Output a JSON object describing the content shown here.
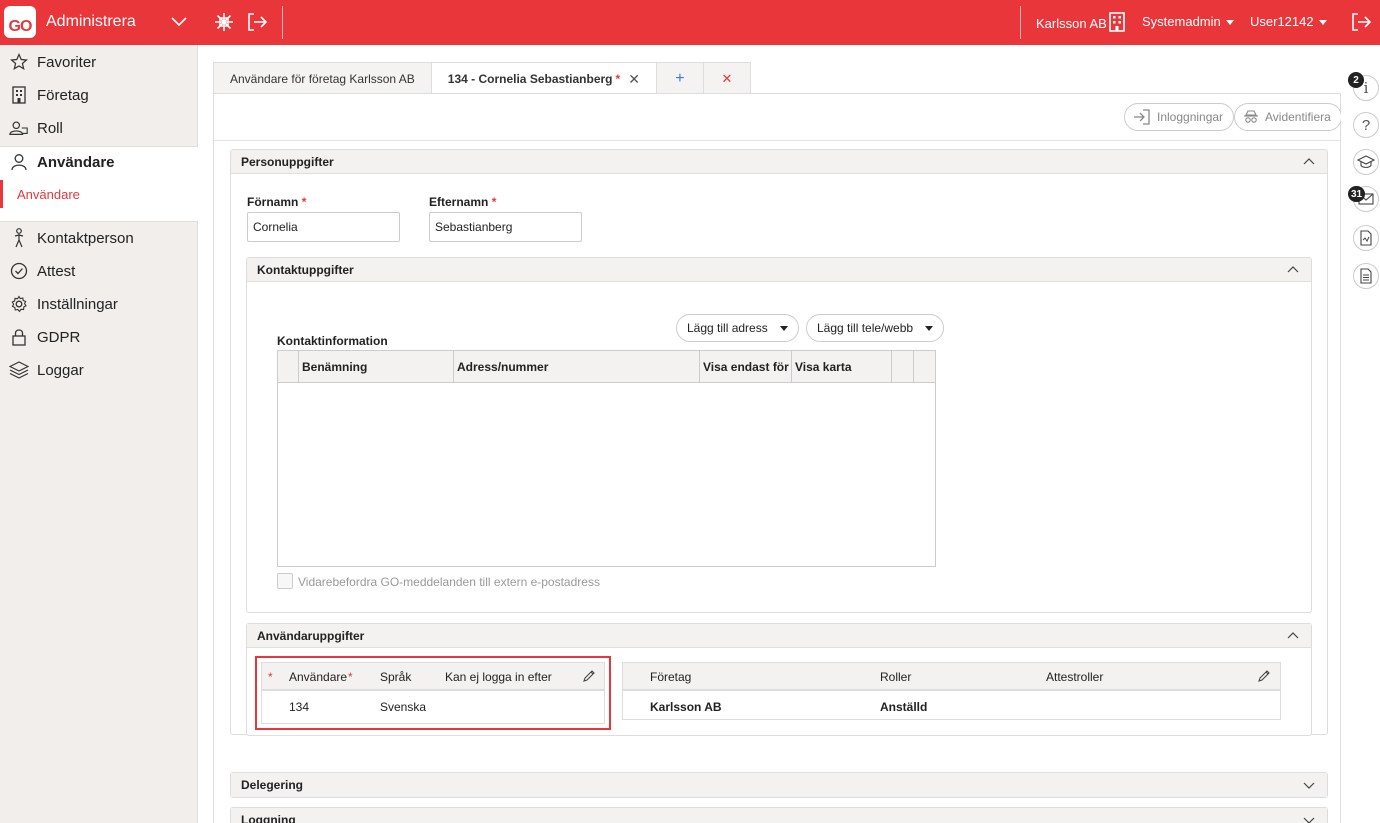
{
  "header": {
    "logo_text": "GO",
    "app_title": "Administrera",
    "company": "Karlsson AB",
    "role": "Systemadmin",
    "user": "User12142",
    "brand_color": "#e8363b"
  },
  "sidebar": {
    "items": [
      {
        "label": "Favoriter",
        "icon": "star-icon"
      },
      {
        "label": "Företag",
        "icon": "building-icon"
      },
      {
        "label": "Roll",
        "icon": "roles-icon"
      },
      {
        "label": "Användare",
        "icon": "user-icon"
      },
      {
        "label": "Kontaktperson",
        "icon": "person-icon"
      },
      {
        "label": "Attest",
        "icon": "check-circle-icon"
      },
      {
        "label": "Inställningar",
        "icon": "gear-icon"
      },
      {
        "label": "GDPR",
        "icon": "lock-icon"
      },
      {
        "label": "Loggar",
        "icon": "layers-icon"
      }
    ],
    "sub_item": "Användare"
  },
  "tabs": [
    {
      "label": "Användare för företag Karlsson AB"
    },
    {
      "label": "134 - Cornelia Sebastianberg",
      "required_mark": "*"
    }
  ],
  "toolbar": {
    "logins_label": "Inloggningar",
    "anonymize_label": "Avidentifiera"
  },
  "personal": {
    "title": "Personuppgifter",
    "firstname_label": "Förnamn",
    "firstname_value": "Cornelia",
    "lastname_label": "Efternamn",
    "lastname_value": "Sebastianberg",
    "required_mark": "*"
  },
  "contact": {
    "title": "Kontaktuppgifter",
    "info_label": "Kontaktinformation",
    "add_address": "Lägg till adress",
    "add_phone": "Lägg till tele/webb",
    "columns": [
      "Benämning",
      "Adress/nummer",
      "Visa endast för ...",
      "Visa karta"
    ],
    "forward_label": "Vidarebefordra GO-meddelanden till extern e-postadress"
  },
  "user_details": {
    "title": "Användaruppgifter",
    "left_columns": [
      "Användare",
      "Språk",
      "Kan ej logga in efter"
    ],
    "left_required": "*",
    "left_rows": [
      {
        "user": "134",
        "language": "Svenska",
        "cannot_login_after": ""
      }
    ],
    "right_columns": [
      "Företag",
      "Roller",
      "Attestroller"
    ],
    "right_rows": [
      {
        "company": "Karlsson AB",
        "roles": "Anställd",
        "attest_roles": ""
      }
    ]
  },
  "delegation": {
    "title": "Delegering"
  },
  "logging": {
    "title": "Loggning"
  },
  "rail": {
    "info_badge": "2",
    "mail_badge": "31"
  }
}
